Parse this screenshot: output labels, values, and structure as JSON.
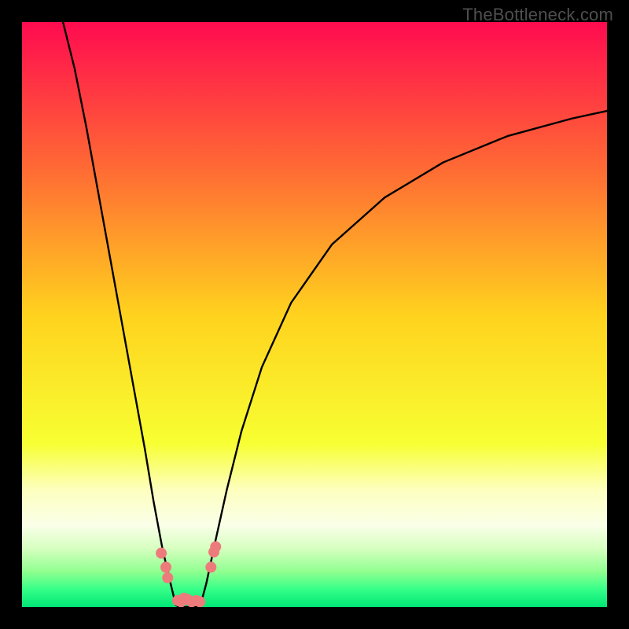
{
  "watermark": "TheBottleneck.com",
  "chart_data": {
    "type": "line",
    "title": "",
    "xlabel": "",
    "ylabel": "",
    "xlim": [
      0,
      100
    ],
    "ylim": [
      0,
      100
    ],
    "background_gradient": {
      "stops": [
        {
          "offset": 0.0,
          "color": "#ff0b4f"
        },
        {
          "offset": 0.25,
          "color": "#ff6a34"
        },
        {
          "offset": 0.5,
          "color": "#ffd21e"
        },
        {
          "offset": 0.72,
          "color": "#f7ff32"
        },
        {
          "offset": 0.8,
          "color": "#fdffbf"
        },
        {
          "offset": 0.86,
          "color": "#faffe8"
        },
        {
          "offset": 0.9,
          "color": "#d6ffc0"
        },
        {
          "offset": 0.94,
          "color": "#8fff8f"
        },
        {
          "offset": 0.97,
          "color": "#35ff88"
        },
        {
          "offset": 1.0,
          "color": "#00e676"
        }
      ]
    },
    "grid": false,
    "series": [
      {
        "name": "curve-left",
        "color": "#000000",
        "width": 2.4,
        "x": [
          7.0,
          9.0,
          11.0,
          13.0,
          15.0,
          17.0,
          19.0,
          21.0,
          22.5,
          24.0,
          25.4,
          26.3
        ],
        "y": [
          100.0,
          92.0,
          82.0,
          71.0,
          60.0,
          49.0,
          38.0,
          27.0,
          18.0,
          10.0,
          4.0,
          0.3
        ]
      },
      {
        "name": "curve-right",
        "color": "#000000",
        "width": 2.4,
        "x": [
          30.5,
          31.5,
          33.0,
          35.0,
          37.5,
          41.0,
          46.0,
          53.0,
          62.0,
          72.0,
          83.0,
          94.0,
          100.0
        ],
        "y": [
          0.3,
          4.0,
          11.0,
          20.0,
          30.0,
          41.0,
          52.0,
          62.0,
          70.0,
          76.0,
          80.5,
          83.5,
          84.8
        ]
      },
      {
        "name": "optimum-floor",
        "color": "#000000",
        "width": 2.4,
        "x": [
          26.3,
          27.0,
          28.0,
          29.0,
          30.0,
          30.5
        ],
        "y": [
          0.3,
          0.0,
          0.0,
          0.0,
          0.0,
          0.3
        ]
      }
    ],
    "markers": {
      "name": "measured-points",
      "color": "#ee7b7b",
      "radius": 7,
      "points": [
        {
          "x": 23.8,
          "y": 9.2
        },
        {
          "x": 24.6,
          "y": 6.8
        },
        {
          "x": 24.9,
          "y": 5.0
        },
        {
          "x": 26.6,
          "y": 1.1
        },
        {
          "x": 27.2,
          "y": 0.9
        },
        {
          "x": 27.7,
          "y": 1.5
        },
        {
          "x": 28.3,
          "y": 1.3
        },
        {
          "x": 29.0,
          "y": 0.9
        },
        {
          "x": 29.8,
          "y": 1.1
        },
        {
          "x": 30.4,
          "y": 0.9
        },
        {
          "x": 32.3,
          "y": 6.8
        },
        {
          "x": 32.8,
          "y": 9.4
        },
        {
          "x": 33.1,
          "y": 10.3
        }
      ]
    }
  }
}
